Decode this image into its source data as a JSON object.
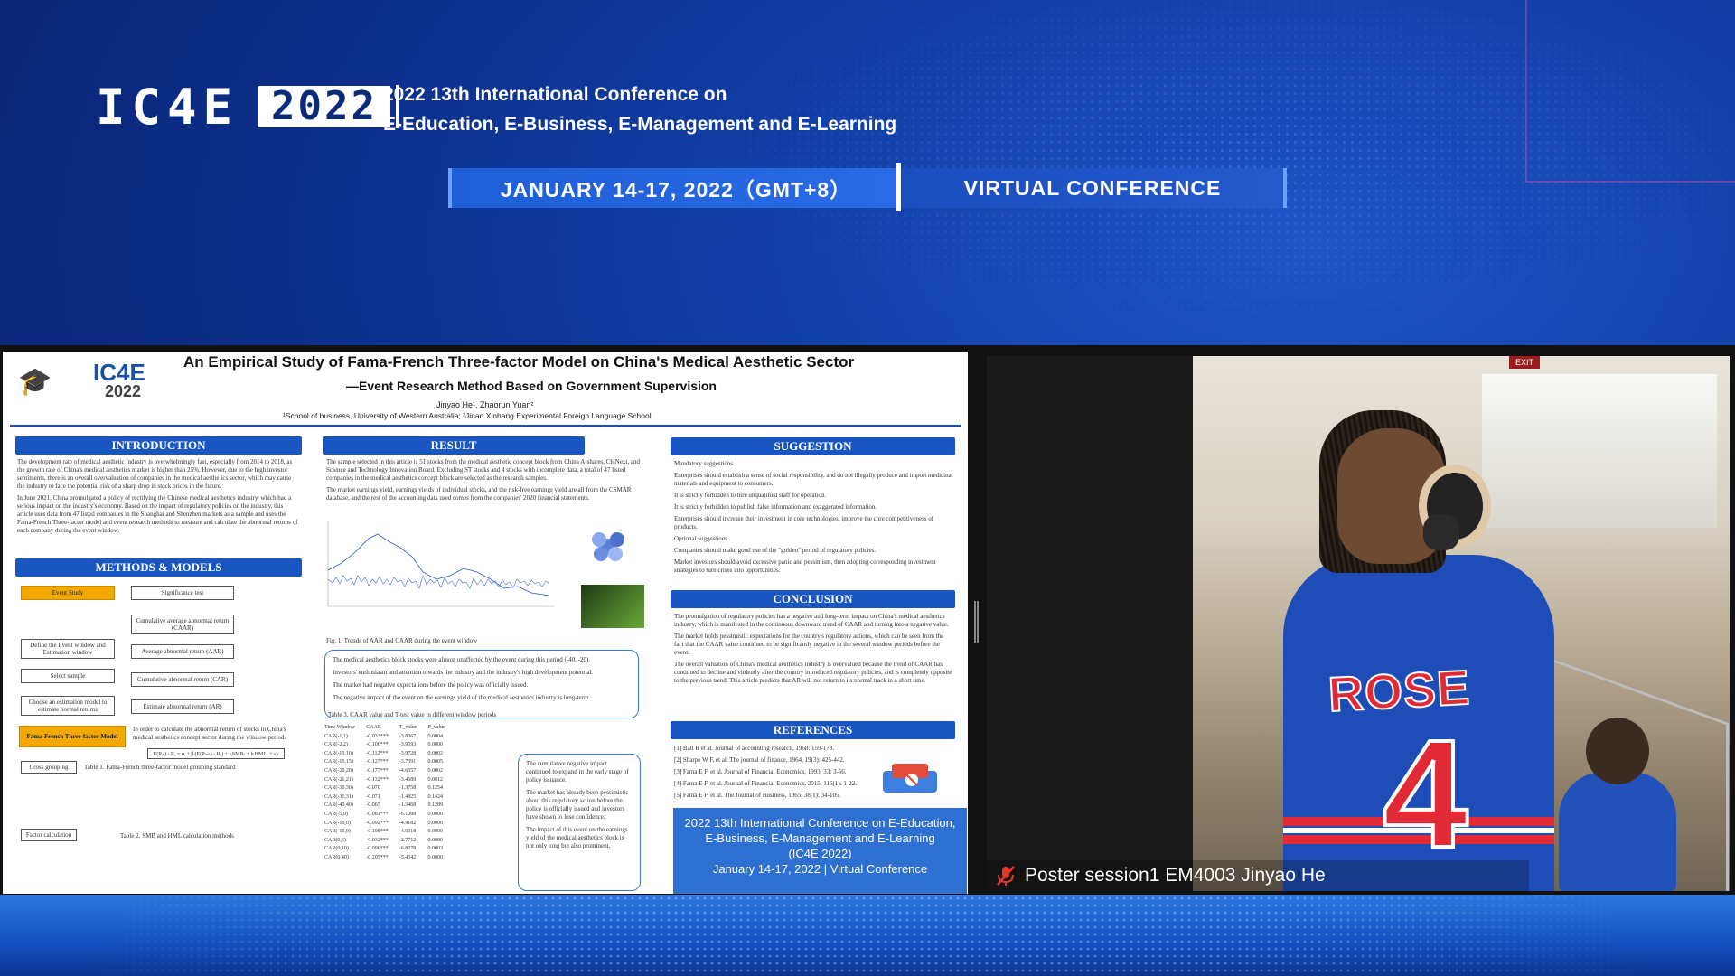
{
  "header": {
    "logo_text": "IC4E",
    "logo_year": "2022",
    "conference_line1": "2022 13th International Conference on",
    "conference_line2": "E-Education, E-Business, E-Management and E-Learning",
    "date_banner": "JANUARY 14-17, 2022（GMT+8）",
    "mode_banner": "VIRTUAL CONFERENCE"
  },
  "poster": {
    "logo_text": "IC4E",
    "logo_year": "2022",
    "title": "An Empirical Study of Fama-French Three-factor Model on China's Medical Aesthetic Sector",
    "subtitle": "—Event Research Method Based on Government Supervision",
    "authors": "Jinyao He¹, Zhaorun Yuan²",
    "affiliations": "¹School of business, University of Western Australia; ²Jinan Xinhang Experimental Foreign Language School",
    "sections": {
      "introduction": "INTRODUCTION",
      "methods": "METHODS & MODELS",
      "result": "RESULT",
      "suggestion": "SUGGESTION",
      "conclusion": "CONCLUSION",
      "references": "REFERENCES"
    },
    "intro_p1": "The development rate of medical aesthetic industry is overwhelmingly fast, especially from 2014 to 2018, as the growth rate of China's medical aesthetics market is higher than 25%. However, due to the high investor sentiments, there is an overall overvaluation of companies in the medical aesthetics sector, which may cause the industry to face the potential risk of a sharp drop in stock prices in the future.",
    "intro_p2": "In June 2021, China promulgated a policy of rectifying the Chinese medical aesthetics industry, which had a serious impact on the industry's economy. Based on the impact of regulatory policies on the industry, this article uses data from 47 listed companies in the Shanghai and Shenzhen markets as a sample and uses the Fama-French Three-factor model and event research methods to measure and calculate the abnormal returns of each company during the event window.",
    "flow": {
      "event_study": "Event Study",
      "significance_test": "Significance test",
      "caar": "Cumulative average abnormal return (CAAR)",
      "define_window": "Define the Event window and Estimation window",
      "aar": "Average abnormal return (AAR)",
      "select_sample": "Select sample",
      "car": "Cumulative abnormal return (CAR)",
      "choose_model": "Choose an estimation model to estimate normal returns",
      "ar": "Estimate abnormal return (AR)",
      "ff_model": "Fama-French Three-factor Model",
      "ff_desc": "In order to calculate the abnormal return of stocks in China's medical aesthetics concept sector during the window period.",
      "formula": "E(Rᵢₜ) - Rₑ = αᵢ + βᵢ(E(Rₘₜ) - Rₑ) + sᵢSMBₜ + hᵢHMLₜ + εᵢₜ",
      "cross_grouping": "Cross grouping",
      "table1_title": "Table 1. Fama-French three-factor model grouping standard",
      "factor_calc": "Factor calculation",
      "table2_title": "Table 2. SMB and HML calculation methods"
    },
    "result_p1": "The sample selected in this article is 51 stocks from the medical aesthetic concept block from China A-shares, ChiNext, and Science and Technology Innovation Board. Excluding ST stocks and 4 stocks with incomplete data, a total of 47 listed companies in the medical aesthetics concept block are selected as the research samples.",
    "result_p2": "The market earnings yield, earnings yields of individual stocks, and the risk-free earnings yield are all from the CSMAR database, and the rest of the accounting data used comes from the companies' 2020 financial statements.",
    "fig1_caption": "Fig. 1. Trends of AAR and CAAR during the event window",
    "result_bullets": [
      "The medical aesthetics block stocks were almost unaffected by the event during this period (-40, -20).",
      "Investors' enthusiasm and attention towards the industry and the industry's high development potential.",
      "The market had negative expectations before the policy was officially issued.",
      "The negative impact of the event on the earnings yield of the medical aesthetics industry is long-term."
    ],
    "table3_title": "Table 3. CAAR value and T-test value in different window periods",
    "table3_headers": [
      "Time Window",
      "CAAR",
      "T_value",
      "P_value"
    ],
    "table3_rows": [
      [
        "CAR(-1,1)",
        "-0.033***",
        "-3.8067",
        "0.0004"
      ],
      [
        "CAR(-2,2)",
        "-0.106***",
        "-3.9593",
        "0.0000"
      ],
      [
        "CAR(-10,10)",
        "-0.112***",
        "-3.9728",
        "0.0002"
      ],
      [
        "CAR(-15,15)",
        "-0.127***",
        "-3.7391",
        "0.0005"
      ],
      [
        "CAR(-20,20)",
        "-0.177***",
        "-4.6557",
        "0.0002"
      ],
      [
        "CAR(-21,21)",
        "-0.132***",
        "-3.4589",
        "0.0012"
      ],
      [
        "CAR(-30,30)",
        "-0.070",
        "-1.3758",
        "0.1254"
      ],
      [
        "CAR(-31,31)",
        "-0.071",
        "-1.4825",
        "0.1424"
      ],
      [
        "CAR(-40,40)",
        "-0.065",
        "-1.3468",
        "0.1289"
      ],
      [
        "CAR(-5,0)",
        "-0.081***",
        "-6.1088",
        "0.0000"
      ],
      [
        "CAR(-10,0)",
        "-0.092***",
        "-4.9182",
        "0.0000"
      ],
      [
        "CAR(-15,0)",
        "-0.108***",
        "-4.6318",
        "0.0000"
      ],
      [
        "CAR(0,5)",
        "-0.032***",
        "-2.7712",
        "0.0080"
      ],
      [
        "CAR(0,10)",
        "-0.096***",
        "-6.8278",
        "0.0003"
      ],
      [
        "CAR(0,40)",
        "-0.205***",
        "-5.4542",
        "0.0000"
      ]
    ],
    "result_right_bullets": [
      "The cumulative negative impact continued to expand in the early stage of policy issuance.",
      "The market has already been pessimistic about this regulatory action before the policy is officially issued and investors have shown to lose confidence.",
      "The impact of this event on the earnings yield of the medical aesthetics block is not only long but also prominent."
    ],
    "suggestions": [
      "Mandatory suggestions",
      "Enterprises should establish a sense of social responsibility, and do not illegally produce and import medicinal materials and equipment to consumers.",
      "It is strictly forbidden to hire unqualified staff for operation.",
      "It is strictly forbidden to publish false information and exaggerated information.",
      "Enterprises should increase their investment in core technologies, improve the core competitiveness of products.",
      "Optional suggestions",
      "Companies should make good use of the \"golden\" period of regulatory policies.",
      "Market investors should avoid excessive panic and pessimism, then adopting corresponding investment strategies to turn crises into opportunities."
    ],
    "conclusions": [
      "The promulgation of regulatory policies has a negative and long-term impact on China's medical aesthetics industry, which is manifested in the continuous downward trend of CAAR and turning into a negative value.",
      "The market holds pessimistic expectations for the country's regulatory actions, which can be seen from the fact that the CAAR value continued to be significantly negative in the several window periods before the event.",
      "The overall valuation of China's medical aesthetics industry is overvalued because the trend of CAAR has continued to decline and violently after the country introduced regulatory policies, and is completely opposite to the previous trend. This article predicts that AR will not return to its normal track in a short time."
    ],
    "references": [
      "[1] Ball R et al. Journal of accounting research, 1968: 159-178.",
      "[2] Sharpe W F, et al. The journal of finance, 1964, 19(3): 425-442.",
      "[3] Fama E F, et al. Journal of Financial Economics, 1993, 33: 3-56.",
      "[4] Fama E F, et al. Journal of Financial Economics, 2015, 116(1): 1-22.",
      "[5] Fama E F, et al. The Journal of Business, 1965, 38(1): 34-105."
    ],
    "footer_box": {
      "line1": "2022 13th International Conference on E-Education,",
      "line2": "E-Business, E-Management and E-Learning",
      "line3": "(IC4E 2022)",
      "line4": "January 14-17, 2022 | Virtual Conference"
    }
  },
  "video": {
    "label": "Poster session1 EM4003 Jinyao He",
    "exit_sign": "EXIT",
    "jersey_name": "ROSE",
    "jersey_number": "4",
    "mic_icon": "mic-muted-icon"
  },
  "colors": {
    "brand_blue": "#1a56c2",
    "banner_blue": "#2a6ae6",
    "accent_red": "#e22a36",
    "background": "#0a2a7a"
  }
}
